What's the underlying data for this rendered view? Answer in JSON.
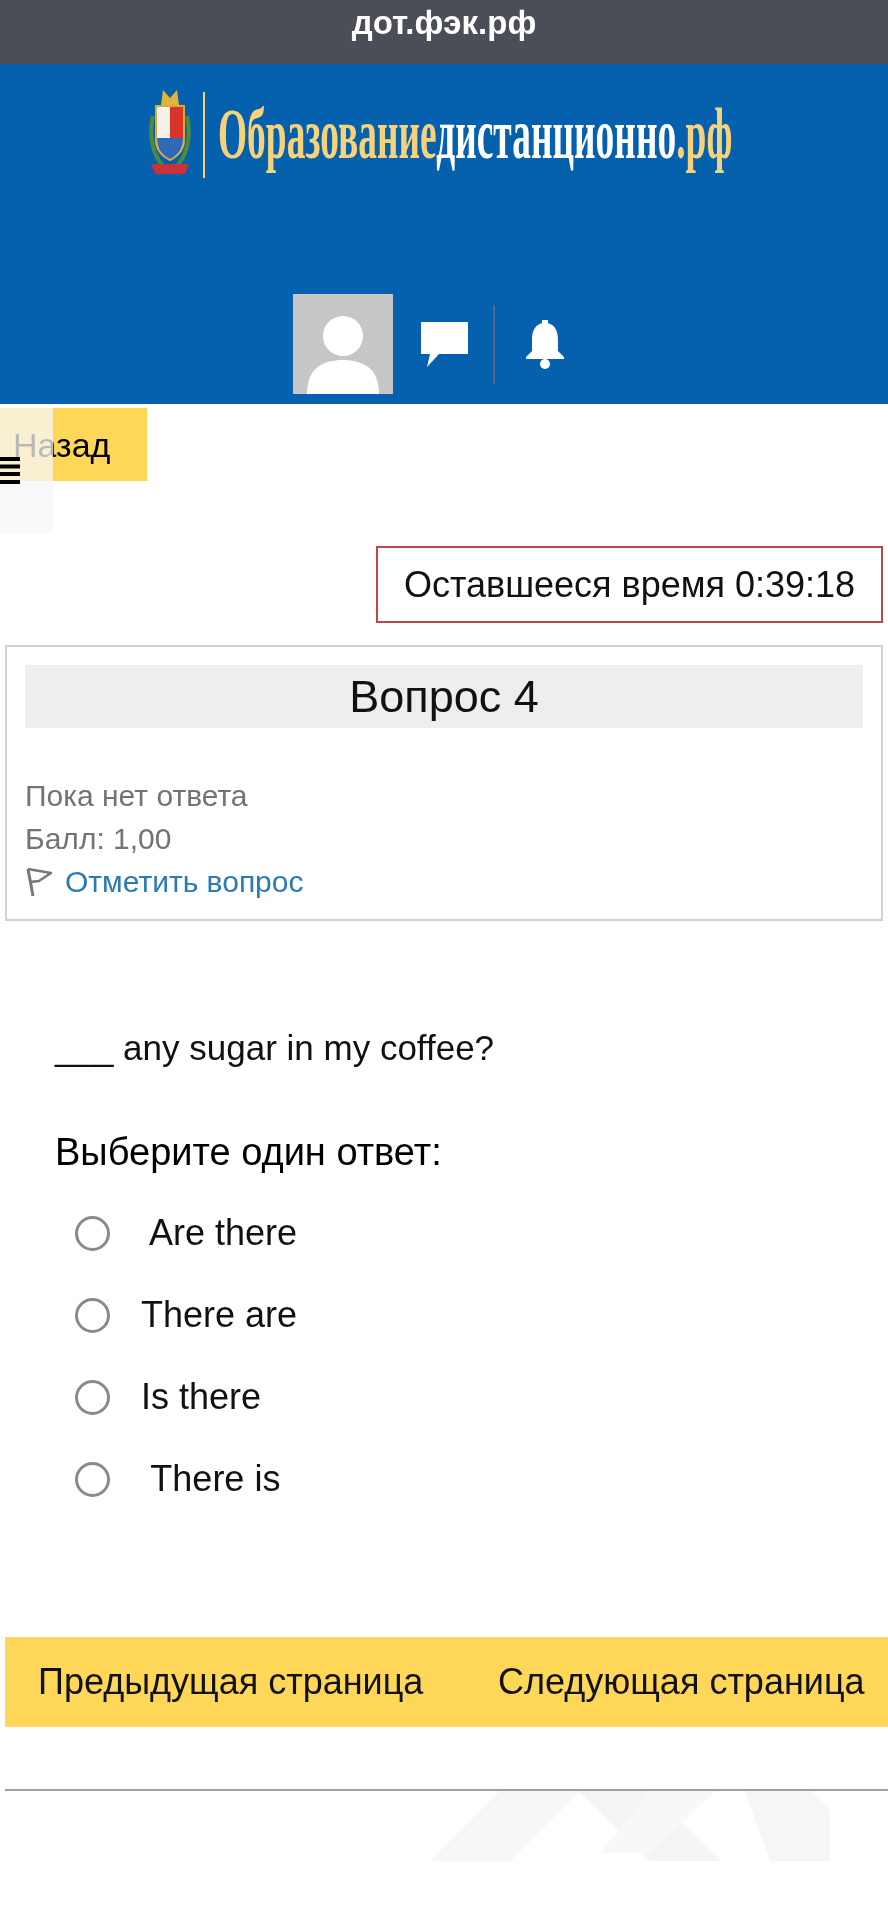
{
  "browser_bar": {
    "address": "дот.фэк.рф"
  },
  "header": {
    "logo": {
      "parts": [
        {
          "text": "Образование",
          "color": "#f6d27a"
        },
        {
          "text": "дистанционно",
          "color": "#ffffff"
        },
        {
          "text": ".рф",
          "color": "#f6d27a"
        }
      ]
    }
  },
  "nav": {
    "back_button": "Назад"
  },
  "timer": {
    "text": "Оставшееся время 0:39:18"
  },
  "question_info": {
    "title": "Вопрос 4",
    "state": "Пока нет ответа",
    "mark": "Балл: 1,00",
    "flag_link": "Отметить вопрос",
    "flagged": false
  },
  "question": {
    "text": "___ any sugar in my coffee?",
    "prompt": "Выберите один ответ:",
    "options": [
      {
        "label": " Are there",
        "selected": false
      },
      {
        "label": "There are",
        "selected": false
      },
      {
        "label": "Is there",
        "selected": false
      },
      {
        "label": " There is",
        "selected": false
      }
    ]
  },
  "page_nav": {
    "buttons": [
      "Предыдущая страница",
      "Следующая страница"
    ]
  }
}
